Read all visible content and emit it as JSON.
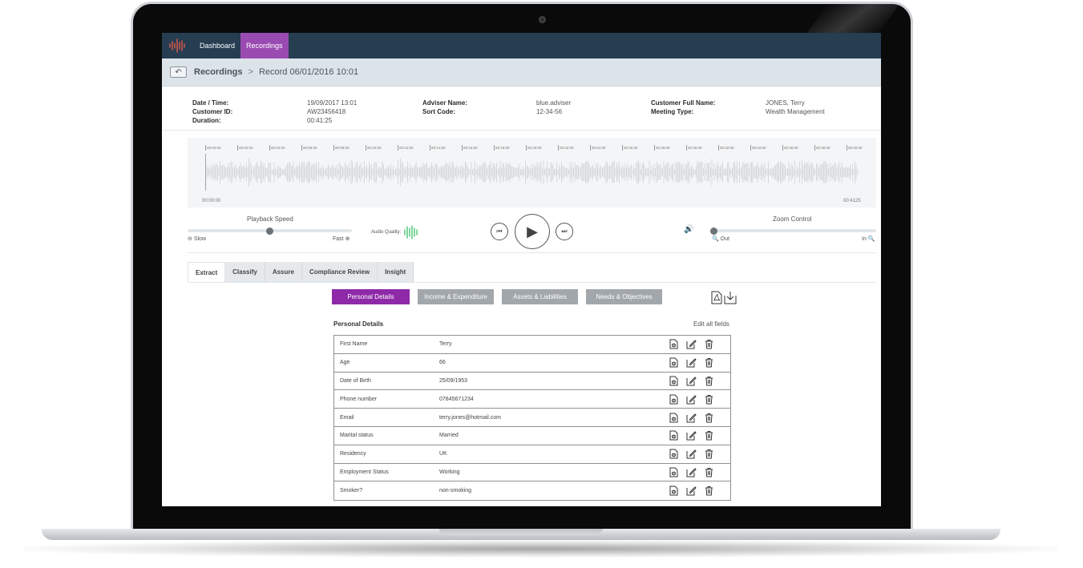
{
  "nav": {
    "tabs": [
      {
        "label": "Dashboard",
        "active": false
      },
      {
        "label": "Recordings",
        "active": true
      }
    ]
  },
  "breadcrumb": {
    "root": "Recordings",
    "separator": ">",
    "current": "Record 06/01/2016  10:01"
  },
  "meta": {
    "col1": {
      "labels": [
        "Date / Time:",
        "Customer ID:",
        "Duration:"
      ],
      "values": [
        "19/09/2017 13:01",
        "AW23456418",
        "00:41:25"
      ]
    },
    "col2": {
      "labels": [
        "Adviser Name:",
        "Sort Code:"
      ],
      "values": [
        "blue.adviser",
        "12-34-56"
      ]
    },
    "col3": {
      "labels": [
        "Customer Full Name:",
        "Meeting Type:"
      ],
      "values": [
        "JONES, Terry",
        "Wealth Management"
      ]
    }
  },
  "waveform": {
    "ticks": [
      "00:00:00",
      "00:02:00",
      "00:04:00",
      "00:06:00",
      "00:08:00",
      "00:10:00",
      "00:12:00",
      "00:14:00",
      "00:16:00",
      "00:18:00",
      "00:20:00",
      "00:22:00",
      "00:24:00",
      "00:26:00",
      "00:28:00",
      "00:30:00",
      "00:32:00",
      "00:34:00",
      "00:36:00",
      "00:38:00",
      "00:40:00"
    ],
    "start_time": "00:00:00",
    "end_time": "00:4125"
  },
  "controls": {
    "playback_speed_label": "Playback Speed",
    "slow_label": "Slow",
    "fast_label": "Fast",
    "audio_quality_label": "Audio Quality:",
    "zoom_label": "Zoom Control",
    "zoom_out_label": "Out",
    "zoom_in_label": "In",
    "playback_speed_value": 0.5,
    "zoom_value": 0.0
  },
  "tabs": [
    {
      "label": "Extract",
      "active": true
    },
    {
      "label": "Classify",
      "active": false
    },
    {
      "label": "Assure",
      "active": false
    },
    {
      "label": "Compliance Review",
      "active": false
    },
    {
      "label": "Insight",
      "active": false
    }
  ],
  "subtabs": [
    {
      "label": "Personal Details",
      "active": true
    },
    {
      "label": "Income & Expenditure",
      "active": false
    },
    {
      "label": "Assets & Liabilities",
      "active": false
    },
    {
      "label": "Needs & Objectives",
      "active": false
    }
  ],
  "section": {
    "title": "Personal Details",
    "edit_all": "Edit all fields"
  },
  "fields": [
    {
      "label": "First Name",
      "value": "Terry"
    },
    {
      "label": "Age",
      "value": "66"
    },
    {
      "label": "Date of Birth",
      "value": "25/09/1953"
    },
    {
      "label": "Phone number",
      "value": "07845671234"
    },
    {
      "label": "Email",
      "value": "terry.jones@hotmail.com"
    },
    {
      "label": "Marital status",
      "value": "Married"
    },
    {
      "label": "Residency",
      "value": "UK"
    },
    {
      "label": "Employment Status",
      "value": "Working"
    },
    {
      "label": "Smoker?",
      "value": "non-smoking"
    }
  ],
  "colors": {
    "topbar": "#263d52",
    "accent": "#9a4bb2",
    "subtab_active": "#8e2aa8",
    "audio_quality": "#3cc06b"
  }
}
